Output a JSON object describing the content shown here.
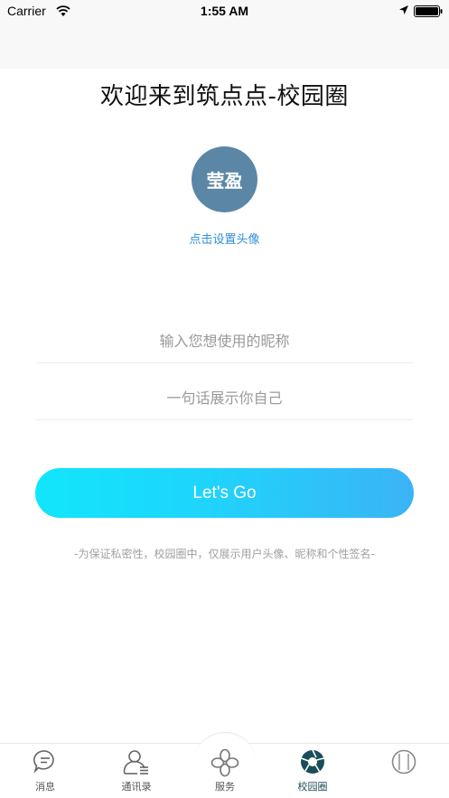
{
  "status_bar": {
    "carrier": "Carrier",
    "time": "1:55 AM"
  },
  "welcome_title": "欢迎来到筑点点-校园圈",
  "avatar": {
    "text": "莹盈",
    "hint": "点击设置头像",
    "color": "#5b86a6"
  },
  "form": {
    "nickname_placeholder": "输入您想使用的昵称",
    "signature_placeholder": "一句话展示你自己"
  },
  "go_button": {
    "label": "Let's Go"
  },
  "privacy_note": "-为保证私密性，校园圈中，仅展示用户头像、昵称和个性签名-",
  "tabs": [
    {
      "label": "消息",
      "icon": "message-icon"
    },
    {
      "label": "通讯录",
      "icon": "contacts-icon"
    },
    {
      "label": "服务",
      "icon": "service-icon"
    },
    {
      "label": "校园圈",
      "icon": "campus-icon",
      "active": true
    },
    {
      "label": "",
      "icon": "me-icon"
    }
  ],
  "colors": {
    "accent": "#1fd4fb",
    "link": "#2f8fd8",
    "active_tab": "#1a4d5a"
  }
}
